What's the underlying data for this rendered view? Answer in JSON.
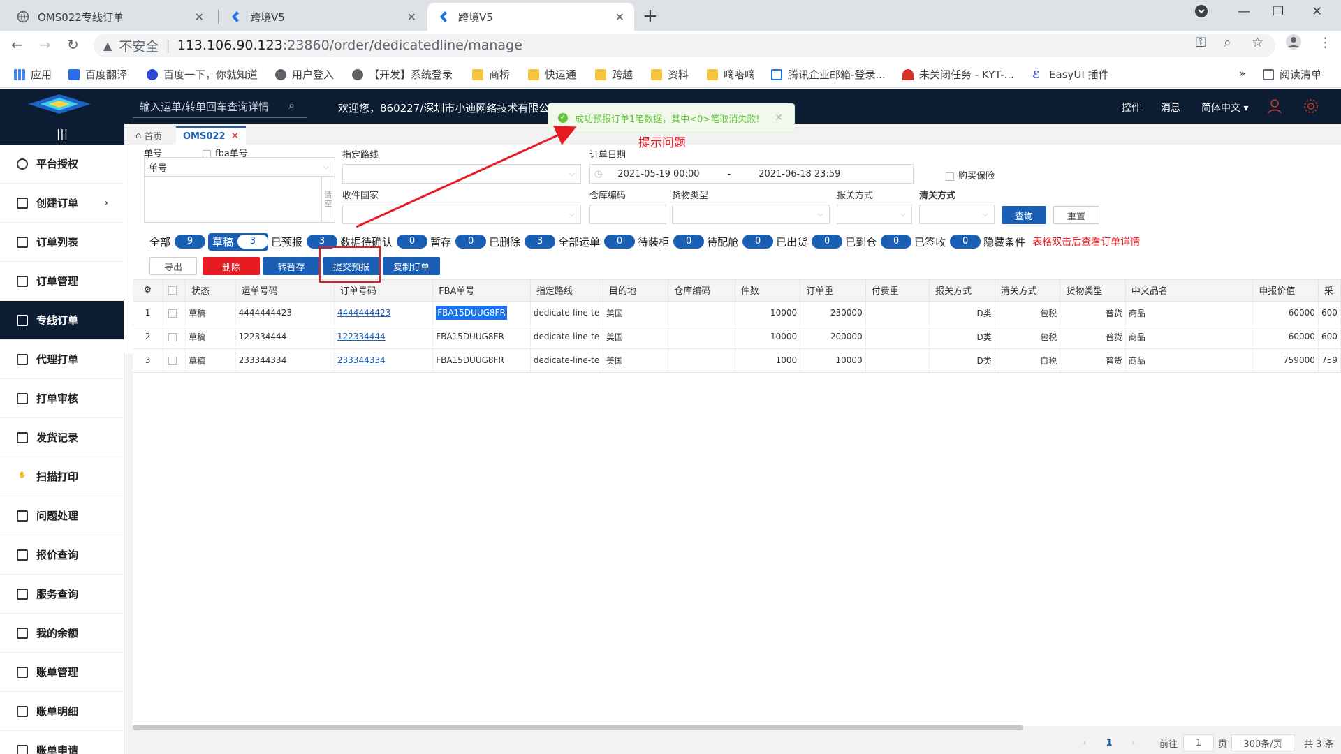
{
  "browser": {
    "tabs": [
      {
        "title": "OMS022专线订单",
        "close": "✕"
      },
      {
        "title": "跨境V5",
        "close": "✕"
      },
      {
        "title": "跨境V5",
        "close": "✕"
      }
    ],
    "new_tab": "+",
    "address": {
      "warning": "▲",
      "insecure": "不安全",
      "host": "113.106.90.123",
      "path": ":23860/order/dedicatedline/manage"
    },
    "bookmarks": [
      "应用",
      "百度翻译",
      "百度一下，你就知道",
      "用户登入",
      "【开发】系统登录",
      "商桥",
      "快运通",
      "跨越",
      "资料",
      "嘀嗒嘀",
      "腾讯企业邮箱-登录...",
      "未关闭任务 - KYT-...",
      "EasyUI 插件"
    ],
    "bookmarks_more": "»",
    "reading_list": "阅读清单",
    "colors": {
      "accent": "#1a5fb4",
      "header_bg": "#0b1c33",
      "danger": "#e81b23",
      "success": "#67c23a"
    }
  },
  "header": {
    "search_placeholder": "输入运单/转单回车查询详情",
    "welcome": "欢迎您，860227/深圳市小迪网络技术有限公",
    "links": [
      "控件",
      "消息",
      "简体中文"
    ]
  },
  "sidebar": {
    "toggle": "|||",
    "items": [
      {
        "label": "平台授权",
        "has_arrow": false,
        "active": false
      },
      {
        "label": "创建订单",
        "has_arrow": true,
        "active": false
      },
      {
        "label": "订单列表",
        "has_arrow": false,
        "active": false
      },
      {
        "label": "订单管理",
        "has_arrow": false,
        "active": false
      },
      {
        "label": "专线订单",
        "has_arrow": false,
        "active": true
      },
      {
        "label": "代理打单",
        "has_arrow": false,
        "active": false
      },
      {
        "label": "打单审核",
        "has_arrow": false,
        "active": false
      },
      {
        "label": "发货记录",
        "has_arrow": false,
        "active": false
      },
      {
        "label": "扫描打印",
        "has_arrow": false,
        "active": false
      },
      {
        "label": "问题处理",
        "has_arrow": false,
        "active": false
      },
      {
        "label": "报价查询",
        "has_arrow": false,
        "active": false
      },
      {
        "label": "服务查询",
        "has_arrow": false,
        "active": false
      },
      {
        "label": "我的余额",
        "has_arrow": false,
        "active": false
      },
      {
        "label": "账单管理",
        "has_arrow": false,
        "active": false
      },
      {
        "label": "账单明细",
        "has_arrow": false,
        "active": false
      },
      {
        "label": "账单申请",
        "has_arrow": false,
        "active": false
      }
    ],
    "arrow": "›"
  },
  "subtabs": {
    "home": "首页",
    "current": "OMS022",
    "close": "✕"
  },
  "form": {
    "order_no_label": "单号",
    "fba_label": "fba单号",
    "order_no_select": "单号",
    "clear_label": "清空",
    "route_label": "指定路线",
    "country_label": "收件国家",
    "date_label": "订单日期",
    "date_start": "2021-05-19 00:00",
    "date_sep": "-",
    "date_end": "2021-06-18 23:59",
    "insurance_label": "购买保险",
    "warehouse_label": "仓库编码",
    "goods_type_label": "货物类型",
    "declare_label": "报关方式",
    "clearance_label": "清关方式",
    "query_btn": "查询",
    "reset_btn": "重置"
  },
  "status_tabs": [
    {
      "label": "全部",
      "count": "9",
      "active": false
    },
    {
      "label": "草稿",
      "count": "3",
      "active": true
    },
    {
      "label": "已预报",
      "count": "3",
      "active": false
    },
    {
      "label": "数据待确认",
      "count": "0",
      "active": false
    },
    {
      "label": "暂存",
      "count": "0",
      "active": false
    },
    {
      "label": "已删除",
      "count": "3",
      "active": false
    },
    {
      "label": "全部运单",
      "count": "0",
      "active": false
    },
    {
      "label": "待装柜",
      "count": "0",
      "active": false
    },
    {
      "label": "待配舱",
      "count": "0",
      "active": false
    },
    {
      "label": "已出货",
      "count": "0",
      "active": false
    },
    {
      "label": "已到仓",
      "count": "0",
      "active": false
    },
    {
      "label": "已签收",
      "count": "0",
      "active": false
    }
  ],
  "hide_conditions": "隐藏条件",
  "table_hint": "表格双击后查看订单详情",
  "actions": {
    "export": "导出",
    "delete": "删除",
    "to_temp": "转暂存",
    "submit_forecast": "提交预报",
    "copy_order": "复制订单"
  },
  "table": {
    "columns": [
      "状态",
      "运单号码",
      "订单号码",
      "FBA单号",
      "指定路线",
      "目的地",
      "仓库编码",
      "件数",
      "订单重",
      "付费重",
      "报关方式",
      "清关方式",
      "货物类型",
      "中文品名",
      "申报价值",
      "采"
    ],
    "rows": [
      {
        "idx": "1",
        "status": "草稿",
        "waybill": "4444444423",
        "order_no": "4444444423",
        "fba": "FBA15DUUG8FR",
        "route": "dedicate-line-te",
        "dest": "美国",
        "warehouse": "",
        "pieces": "10000",
        "weight": "230000",
        "paid_weight": "",
        "declare": "D类",
        "clearance": "包税",
        "goods": "普货",
        "cn_name": "商品",
        "value": "60000",
        "extra": "600"
      },
      {
        "idx": "2",
        "status": "草稿",
        "waybill": "122334444",
        "order_no": "122334444",
        "fba": "FBA15DUUG8FR",
        "route": "dedicate-line-te",
        "dest": "美国",
        "warehouse": "",
        "pieces": "10000",
        "weight": "200000",
        "paid_weight": "",
        "declare": "D类",
        "clearance": "包税",
        "goods": "普货",
        "cn_name": "商品",
        "value": "60000",
        "extra": "600"
      },
      {
        "idx": "3",
        "status": "草稿",
        "waybill": "233344334",
        "order_no": "233344334",
        "fba": "FBA15DUUG8FR",
        "route": "dedicate-line-te",
        "dest": "美国",
        "warehouse": "",
        "pieces": "1000",
        "weight": "10000",
        "paid_weight": "",
        "declare": "D类",
        "clearance": "自税",
        "goods": "普货",
        "cn_name": "商品",
        "value": "759000",
        "extra": "759"
      }
    ]
  },
  "pager": {
    "prev": "‹",
    "page": "1",
    "next": "›",
    "goto": "前往",
    "goto_value": "1",
    "page_unit": "页",
    "page_size": "300条/页",
    "total": "共 3 条"
  },
  "toast": {
    "message": "成功预报订单1笔数据，其中<0>笔取消失败!",
    "close": "✕"
  },
  "annotation": {
    "label": "提示问题"
  }
}
